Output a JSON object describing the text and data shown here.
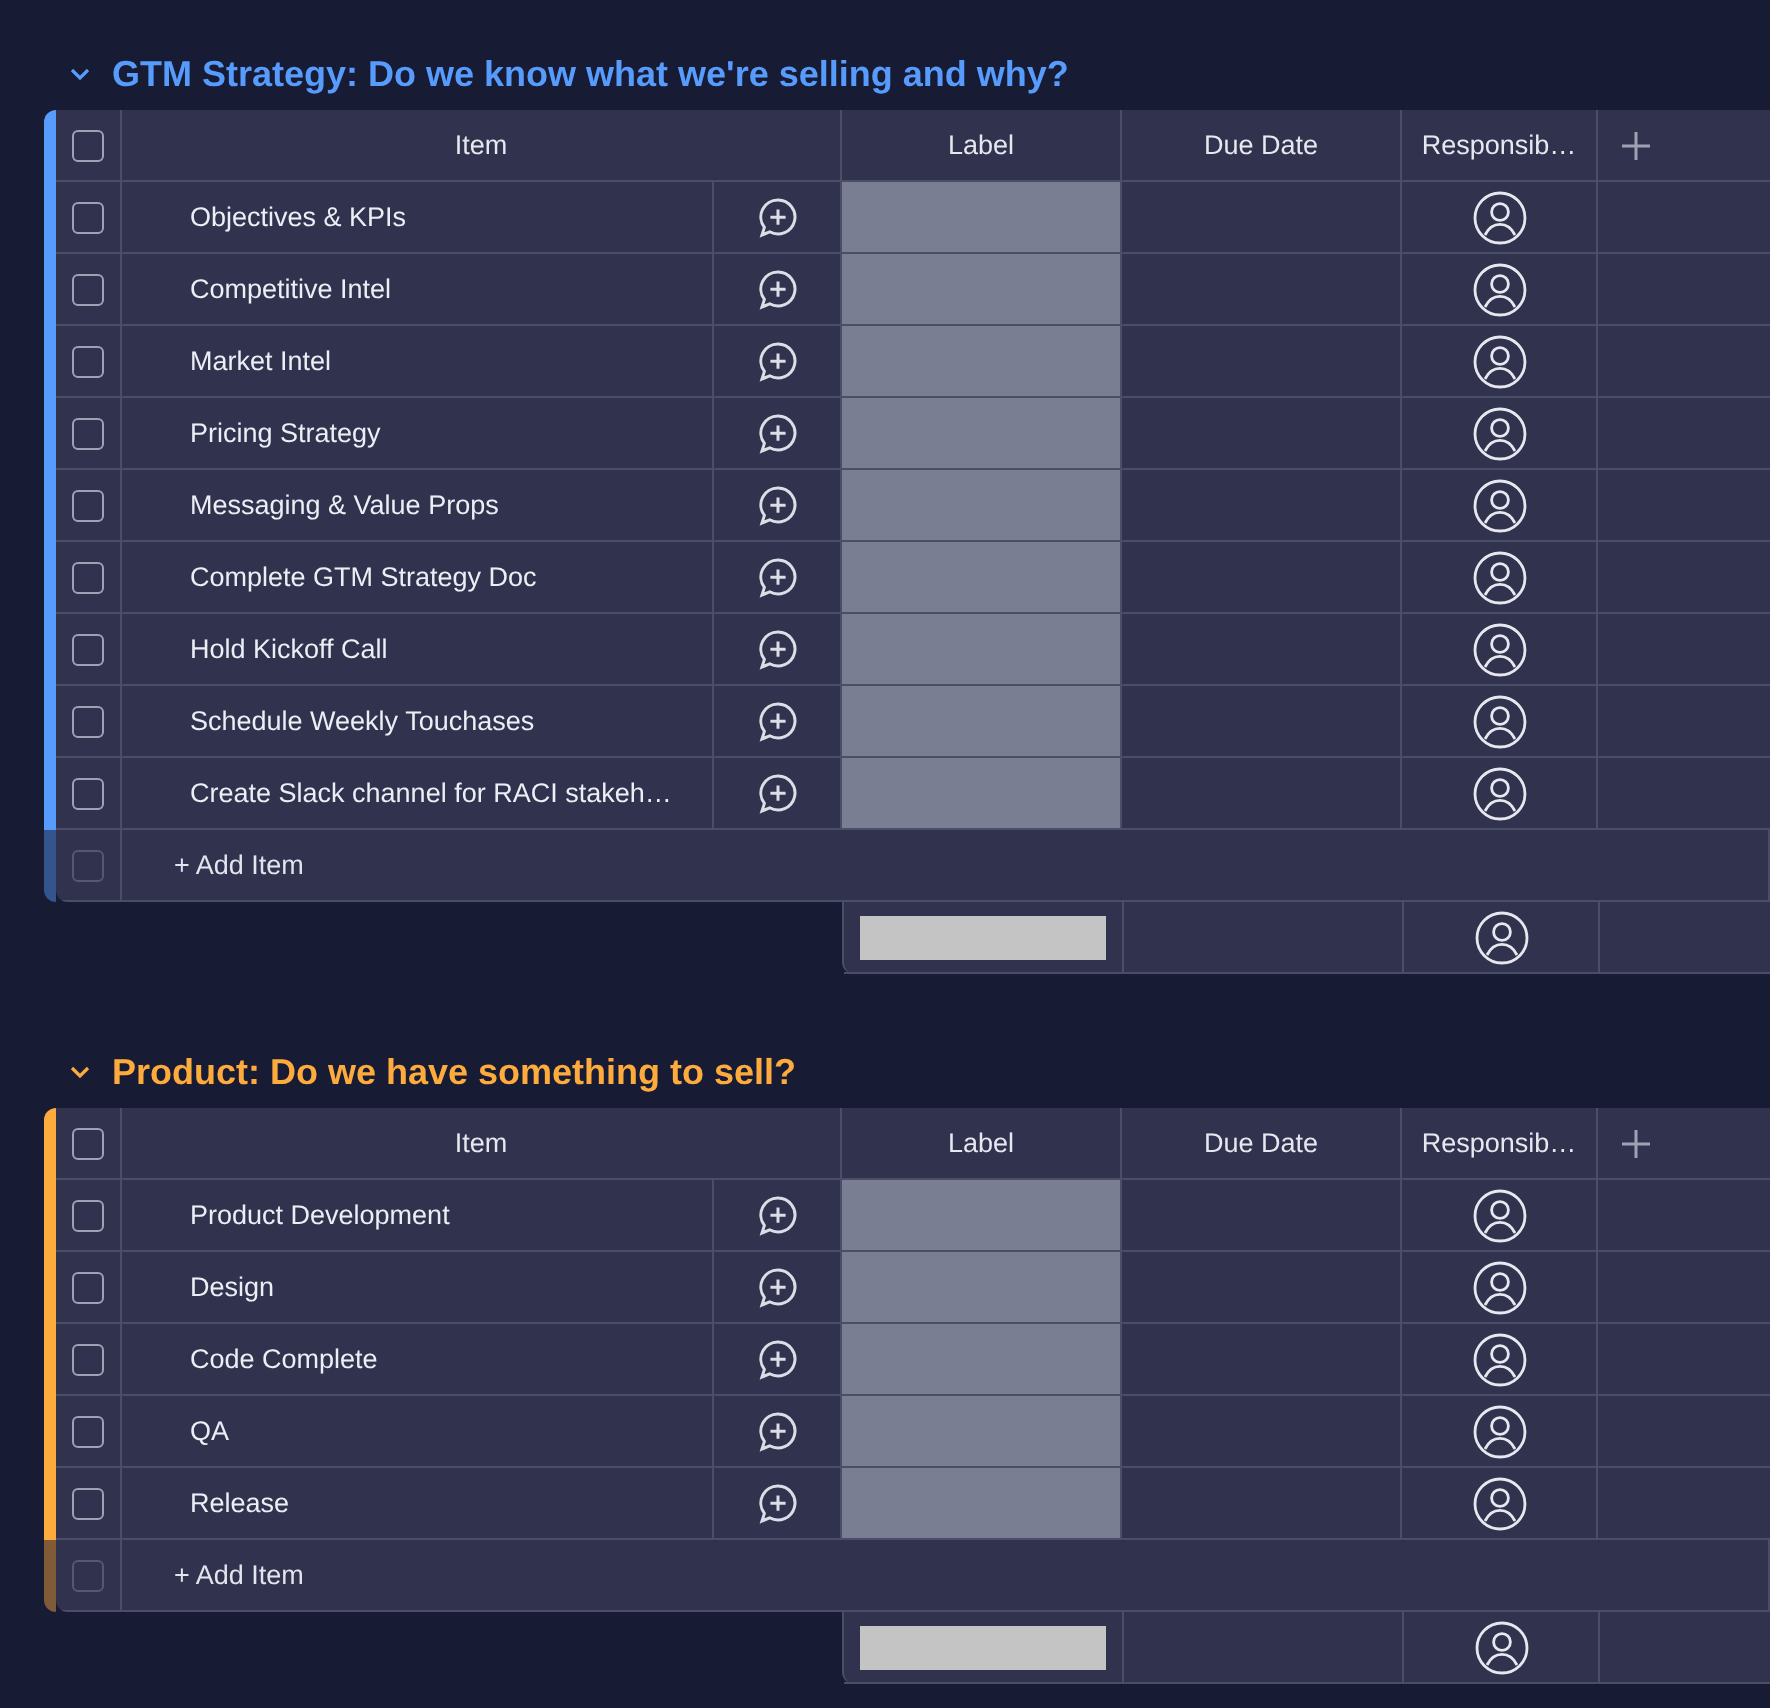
{
  "groups": [
    {
      "title": "GTM Strategy: Do we know what we're selling and why?",
      "color": "#579bfc",
      "expanded": true,
      "header_checked": false,
      "columns": [
        "Item",
        "Label",
        "Due Date",
        "Responsib…"
      ],
      "items": [
        {
          "name": "Objectives & KPIs",
          "checked": false
        },
        {
          "name": "Competitive Intel",
          "checked": false
        },
        {
          "name": "Market Intel",
          "checked": false
        },
        {
          "name": "Pricing Strategy",
          "checked": false
        },
        {
          "name": "Messaging & Value Props",
          "checked": false
        },
        {
          "name": "Complete GTM Strategy Doc",
          "checked": false
        },
        {
          "name": "Hold Kickoff Call",
          "checked": false
        },
        {
          "name": "Schedule Weekly Touchases",
          "checked": false
        },
        {
          "name": "Create Slack channel for RACI stakeh…",
          "checked": false
        }
      ],
      "add_item": {
        "label": "+ Add Item",
        "checkbox_disabled": true
      }
    },
    {
      "title": "Product: Do we have something to sell?",
      "color": "#fdab3d",
      "expanded": true,
      "header_checked": false,
      "columns": [
        "Item",
        "Label",
        "Due Date",
        "Responsib…"
      ],
      "items": [
        {
          "name": "Product Development",
          "checked": false
        },
        {
          "name": "Design",
          "checked": false
        },
        {
          "name": "Code Complete",
          "checked": false
        },
        {
          "name": "QA",
          "checked": false
        },
        {
          "name": "Release",
          "checked": false
        }
      ],
      "add_item": {
        "label": "+ Add Item",
        "checkbox_disabled": true
      }
    }
  ]
}
